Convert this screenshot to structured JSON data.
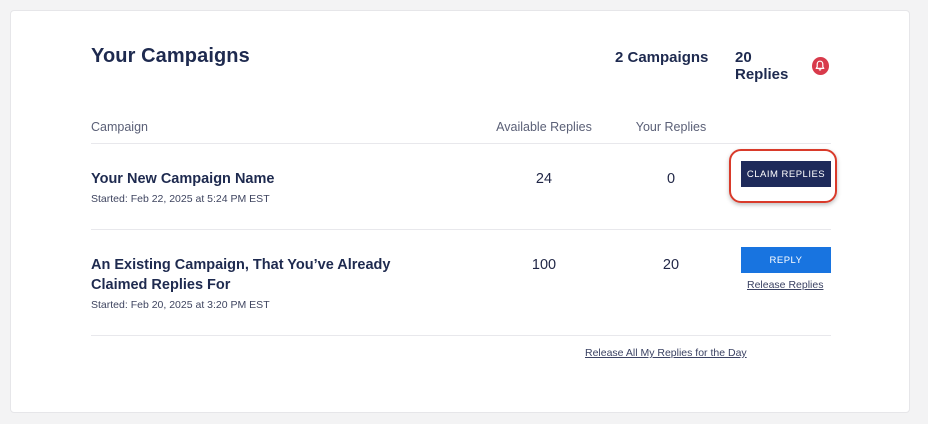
{
  "header": {
    "title": "Your Campaigns",
    "campaign_count": "2 Campaigns",
    "reply_count": "20 Replies",
    "bell_icon": "bell-icon"
  },
  "table": {
    "columns": [
      "Campaign",
      "Available Replies",
      "Your Replies"
    ],
    "rows": [
      {
        "name": "Your New Campaign Name",
        "started": "Started: Feb 22, 2025 at 5:24 PM EST",
        "available": "24",
        "yours": "0",
        "action_label": "CLAIM REPLIES"
      },
      {
        "name": "An Existing Campaign, That You’ve Already Claimed Replies For",
        "started": "Started: Feb 20, 2025 at 3:20 PM EST",
        "available": "100",
        "yours": "20",
        "action_label": "REPLY",
        "secondary_link": "Release Replies"
      }
    ]
  },
  "footer": {
    "release_all_label": "Release All My Replies for the Day"
  },
  "colors": {
    "navy": "#1e2a5a",
    "blue": "#1874e0",
    "alert_red": "#d83a4b",
    "highlight_red": "#d93a2a"
  }
}
